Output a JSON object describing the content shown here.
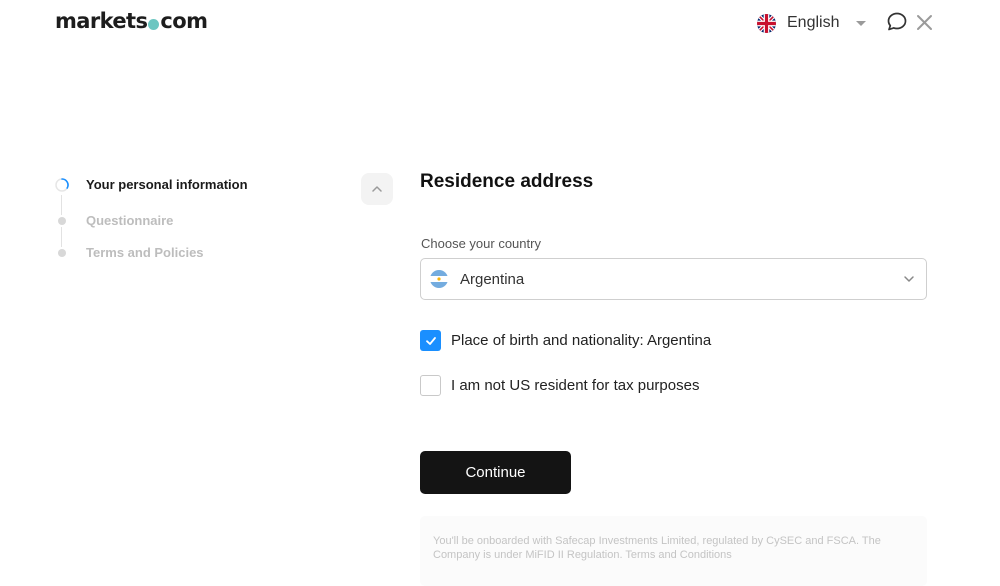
{
  "header": {
    "logo": {
      "part1": "markets",
      "part2": "com"
    },
    "language": {
      "label": "English",
      "flag_icon": "uk-flag-icon"
    },
    "icons": [
      "chat-icon",
      "close-icon"
    ]
  },
  "steps": {
    "items": [
      {
        "label": "Your personal information",
        "state": "active"
      },
      {
        "label": "Questionnaire",
        "state": "pending"
      },
      {
        "label": "Terms and Policies",
        "state": "pending"
      }
    ]
  },
  "form": {
    "title": "Residence address",
    "country": {
      "label": "Choose your country",
      "value": "Argentina",
      "flag_icon": "argentina-flag-icon"
    },
    "checkboxes": [
      {
        "label": "Place of birth and nationality: Argentina",
        "checked": true
      },
      {
        "label": "I am not US resident for tax purposes",
        "checked": false
      }
    ],
    "continue_label": "Continue"
  },
  "notice": {
    "text": "You'll be onboarded with Safecap Investments Limited, regulated by CySEC and FSCA. The Company is under MiFID II Regulation.",
    "link": "Terms and Conditions"
  },
  "colors": {
    "accent": "#1a8fff",
    "logo_dot": "#6cc6c1",
    "button": "#141414"
  }
}
